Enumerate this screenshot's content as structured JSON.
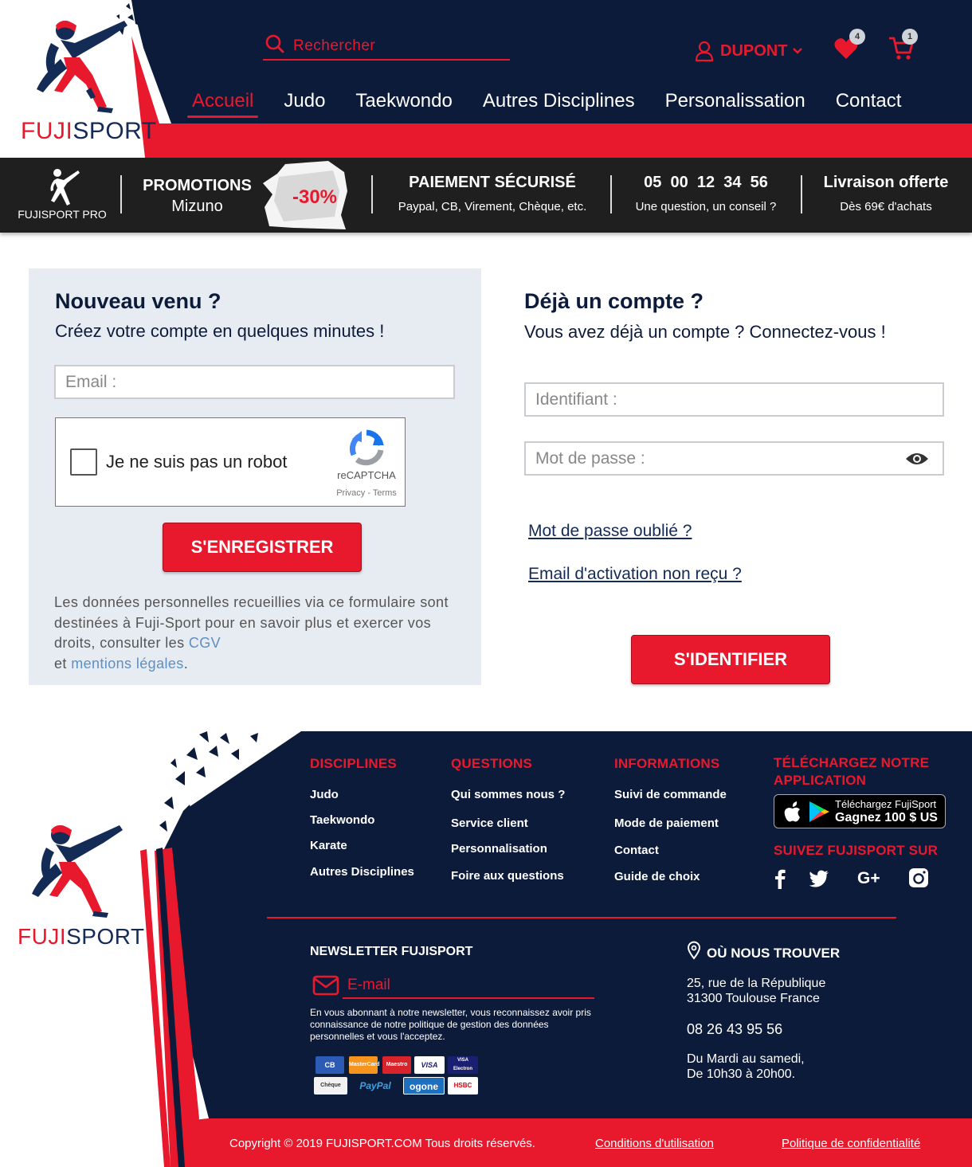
{
  "brand": {
    "name_part1": "FUJI",
    "name_part2": "SPORT"
  },
  "search": {
    "placeholder": "Rechercher"
  },
  "user": {
    "name": "DUPONT"
  },
  "wishlist": {
    "count": "4"
  },
  "cart": {
    "count": "1"
  },
  "nav": [
    {
      "label": "Accueil",
      "active": true
    },
    {
      "label": "Judo"
    },
    {
      "label": "Taekwondo"
    },
    {
      "label": "Autres Disciplines"
    },
    {
      "label": "Personalissation"
    },
    {
      "label": "Contact"
    }
  ],
  "promo_bar": {
    "pro_label": "FUJISPORT PRO",
    "promotions_title": "PROMOTIONS",
    "promotions_sub": "Mizuno",
    "discount": "-30%",
    "payment_title": "PAIEMENT SÉCURISÉ",
    "payment_sub": "Paypal, CB, Virement, Chèque, etc.",
    "phone_title": "05  00  12  34  56",
    "phone_sub": "Une question, un conseil ?",
    "delivery_title": "Livraison offerte",
    "delivery_sub": "Dès 69€ d'achats"
  },
  "register": {
    "title": "Nouveau venu ?",
    "subtitle": "Créez votre compte en quelques minutes !",
    "email_placeholder": "Email :",
    "captcha_label": "Je ne suis pas un robot",
    "captcha_brand": "reCAPTCHA",
    "captcha_links": "Privacy - Terms",
    "button": "S'ENREGISTRER",
    "legal_text": "Les données personnelles recueillies via ce formulaire sont destinées à Fuji-Sport pour en savoir plus et exercer vos droits, consulter les",
    "legal_link_cgv": "CGV",
    "legal_and": "et",
    "legal_link_mentions": "mentions légales",
    "legal_end": "."
  },
  "login": {
    "title": "Déjà un compte ?",
    "subtitle": "Vous avez déjà un compte ? Connectez-vous !",
    "id_placeholder": "Identifiant :",
    "password_placeholder": "Mot de passe :",
    "forgot_link": "Mot de passe oublié ?",
    "activation_link": "Email d'activation non reçu ?",
    "button": "S'IDENTIFIER"
  },
  "footer": {
    "disciplines": {
      "title": "DISCIPLINES",
      "items": [
        "Judo",
        "Taekwondo",
        "Karate",
        "Autres Disciplines"
      ]
    },
    "questions": {
      "title": "QUESTIONS",
      "items": [
        "Qui sommes nous ?",
        "Service client",
        "Personnalisation",
        "Foire aux questions"
      ]
    },
    "informations": {
      "title": "INFORMATIONS",
      "items": [
        "Suivi de commande",
        "Mode de paiement",
        "Contact",
        "Guide de choix"
      ]
    },
    "app": {
      "title_line1": "TÉLÉCHARGEZ NOTRE",
      "title_line2": "APPLICATION",
      "badge_line1": "Téléchargez FujiSport",
      "badge_line2": "Gagnez 100 $ US"
    },
    "social": {
      "title": "SUIVEZ FUJISPORT SUR",
      "icons": [
        "facebook-icon",
        "twitter-icon",
        "google-plus-icon",
        "instagram-icon"
      ]
    },
    "newsletter": {
      "title": "NEWSLETTER  FUJISPORT",
      "placeholder": "E-mail",
      "note": "En vous abonnant à notre newsletter, vous reconnaissez avoir pris connaissance de notre politique de gestion des données personnelles et vous l'acceptez."
    },
    "payments": [
      "CB",
      "MasterCard",
      "Maestro",
      "VISA",
      "VISA Electron",
      "Chèque",
      "PayPal",
      "ogone",
      "HSBC"
    ],
    "location": {
      "title": "OÙ NOUS TROUVER",
      "address_line1": "25, rue de la République",
      "address_line2": "31300 Toulouse France",
      "phone": "08 26 43 95 56",
      "hours_line1": "Du Mardi au samedi,",
      "hours_line2": "De 10h30 à 20h00."
    },
    "copyright": "Copyright © 2019 FUJISPORT.COM Tous droits réservés.",
    "terms_link": "Conditions d'utilisation",
    "privacy_link": "Politique de confidentialité"
  },
  "colors": {
    "navy": "#0d1b3a",
    "red": "#e8192c",
    "dark_bar": "#1f1f1f",
    "panel": "#e7ecf3"
  }
}
